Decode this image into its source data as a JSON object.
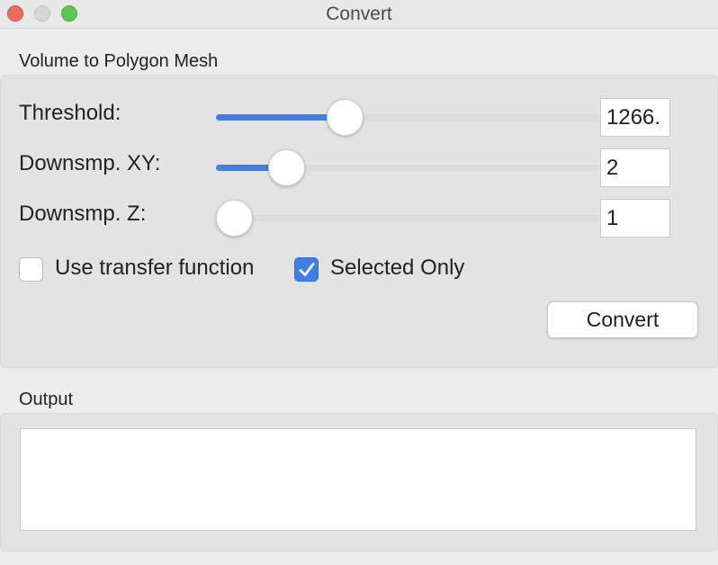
{
  "window": {
    "title": "Convert"
  },
  "volume_group": {
    "title": "Volume to Polygon Mesh",
    "threshold": {
      "label": "Threshold:",
      "value": "1266.",
      "slider_fraction": 0.32
    },
    "downsample_xy": {
      "label": "Downsmp. XY:",
      "value": "2",
      "slider_fraction": 0.15
    },
    "downsample_z": {
      "label": "Downsmp. Z:",
      "value": "1",
      "slider_fraction": 0.0
    },
    "use_transfer_function": {
      "label": "Use transfer function",
      "checked": false
    },
    "selected_only": {
      "label": "Selected Only",
      "checked": true
    },
    "convert_label": "Convert"
  },
  "output_group": {
    "title": "Output",
    "text": ""
  },
  "colors": {
    "accent": "#3d7ee8",
    "close": "#ed6a5e",
    "minimize": "#d6d6d6",
    "maximize": "#61c554"
  }
}
